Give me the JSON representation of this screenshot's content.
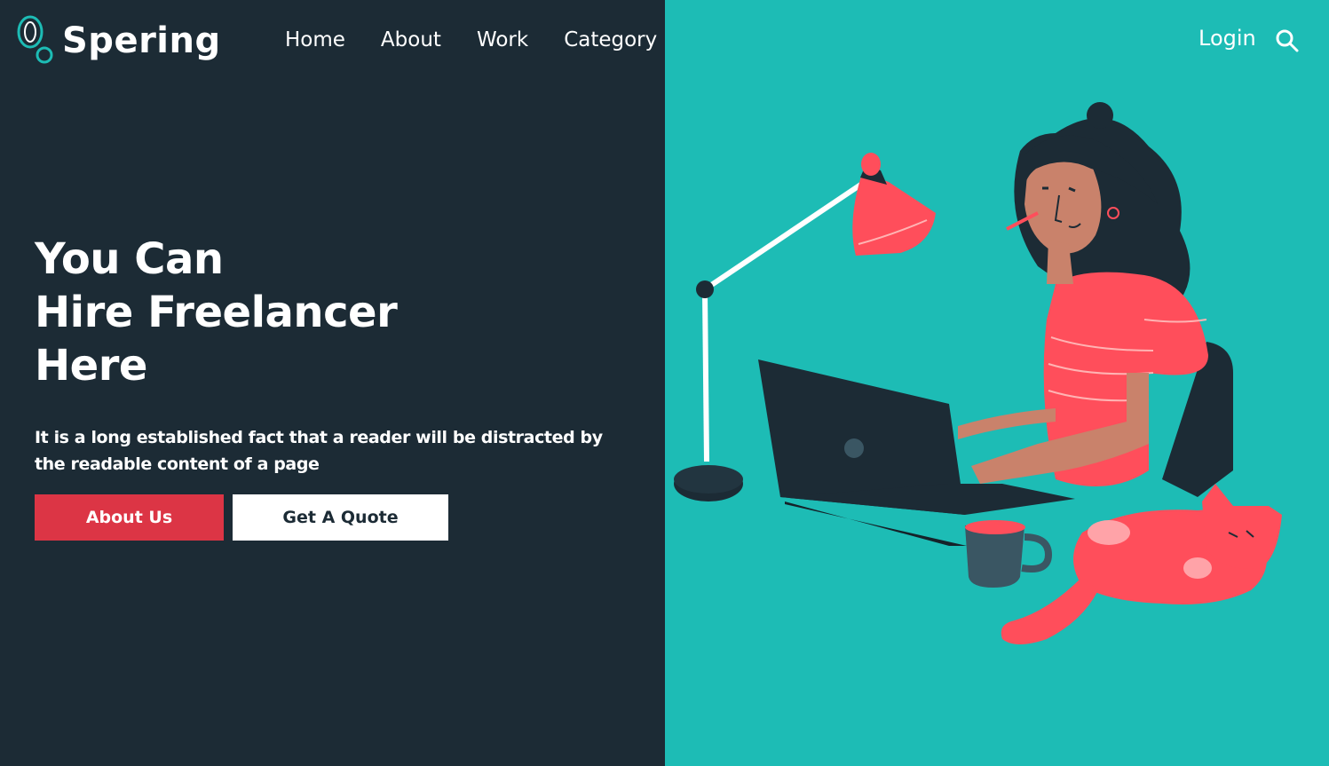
{
  "brand": {
    "name": "Spering",
    "accent": "#1dbcb5"
  },
  "nav": {
    "items": [
      {
        "label": "Home"
      },
      {
        "label": "About"
      },
      {
        "label": "Work"
      },
      {
        "label": "Category"
      }
    ],
    "login_label": "Login",
    "search_icon": "search-icon"
  },
  "hero": {
    "title_lines": [
      "You Can",
      "Hire Freelancer",
      "Here"
    ],
    "text": "It is a long established fact that a reader will be distracted by the readable content of a page",
    "primary_button": "About Us",
    "secondary_button": "Get A Quote"
  },
  "colors": {
    "dark_bg": "#1c2b35",
    "teal_bg": "#1dbcb5",
    "primary_button": "#dc3545",
    "illustration_coral": "#ff4e5b"
  },
  "illustration": "woman-working-at-laptop-with-lamp-and-cat"
}
